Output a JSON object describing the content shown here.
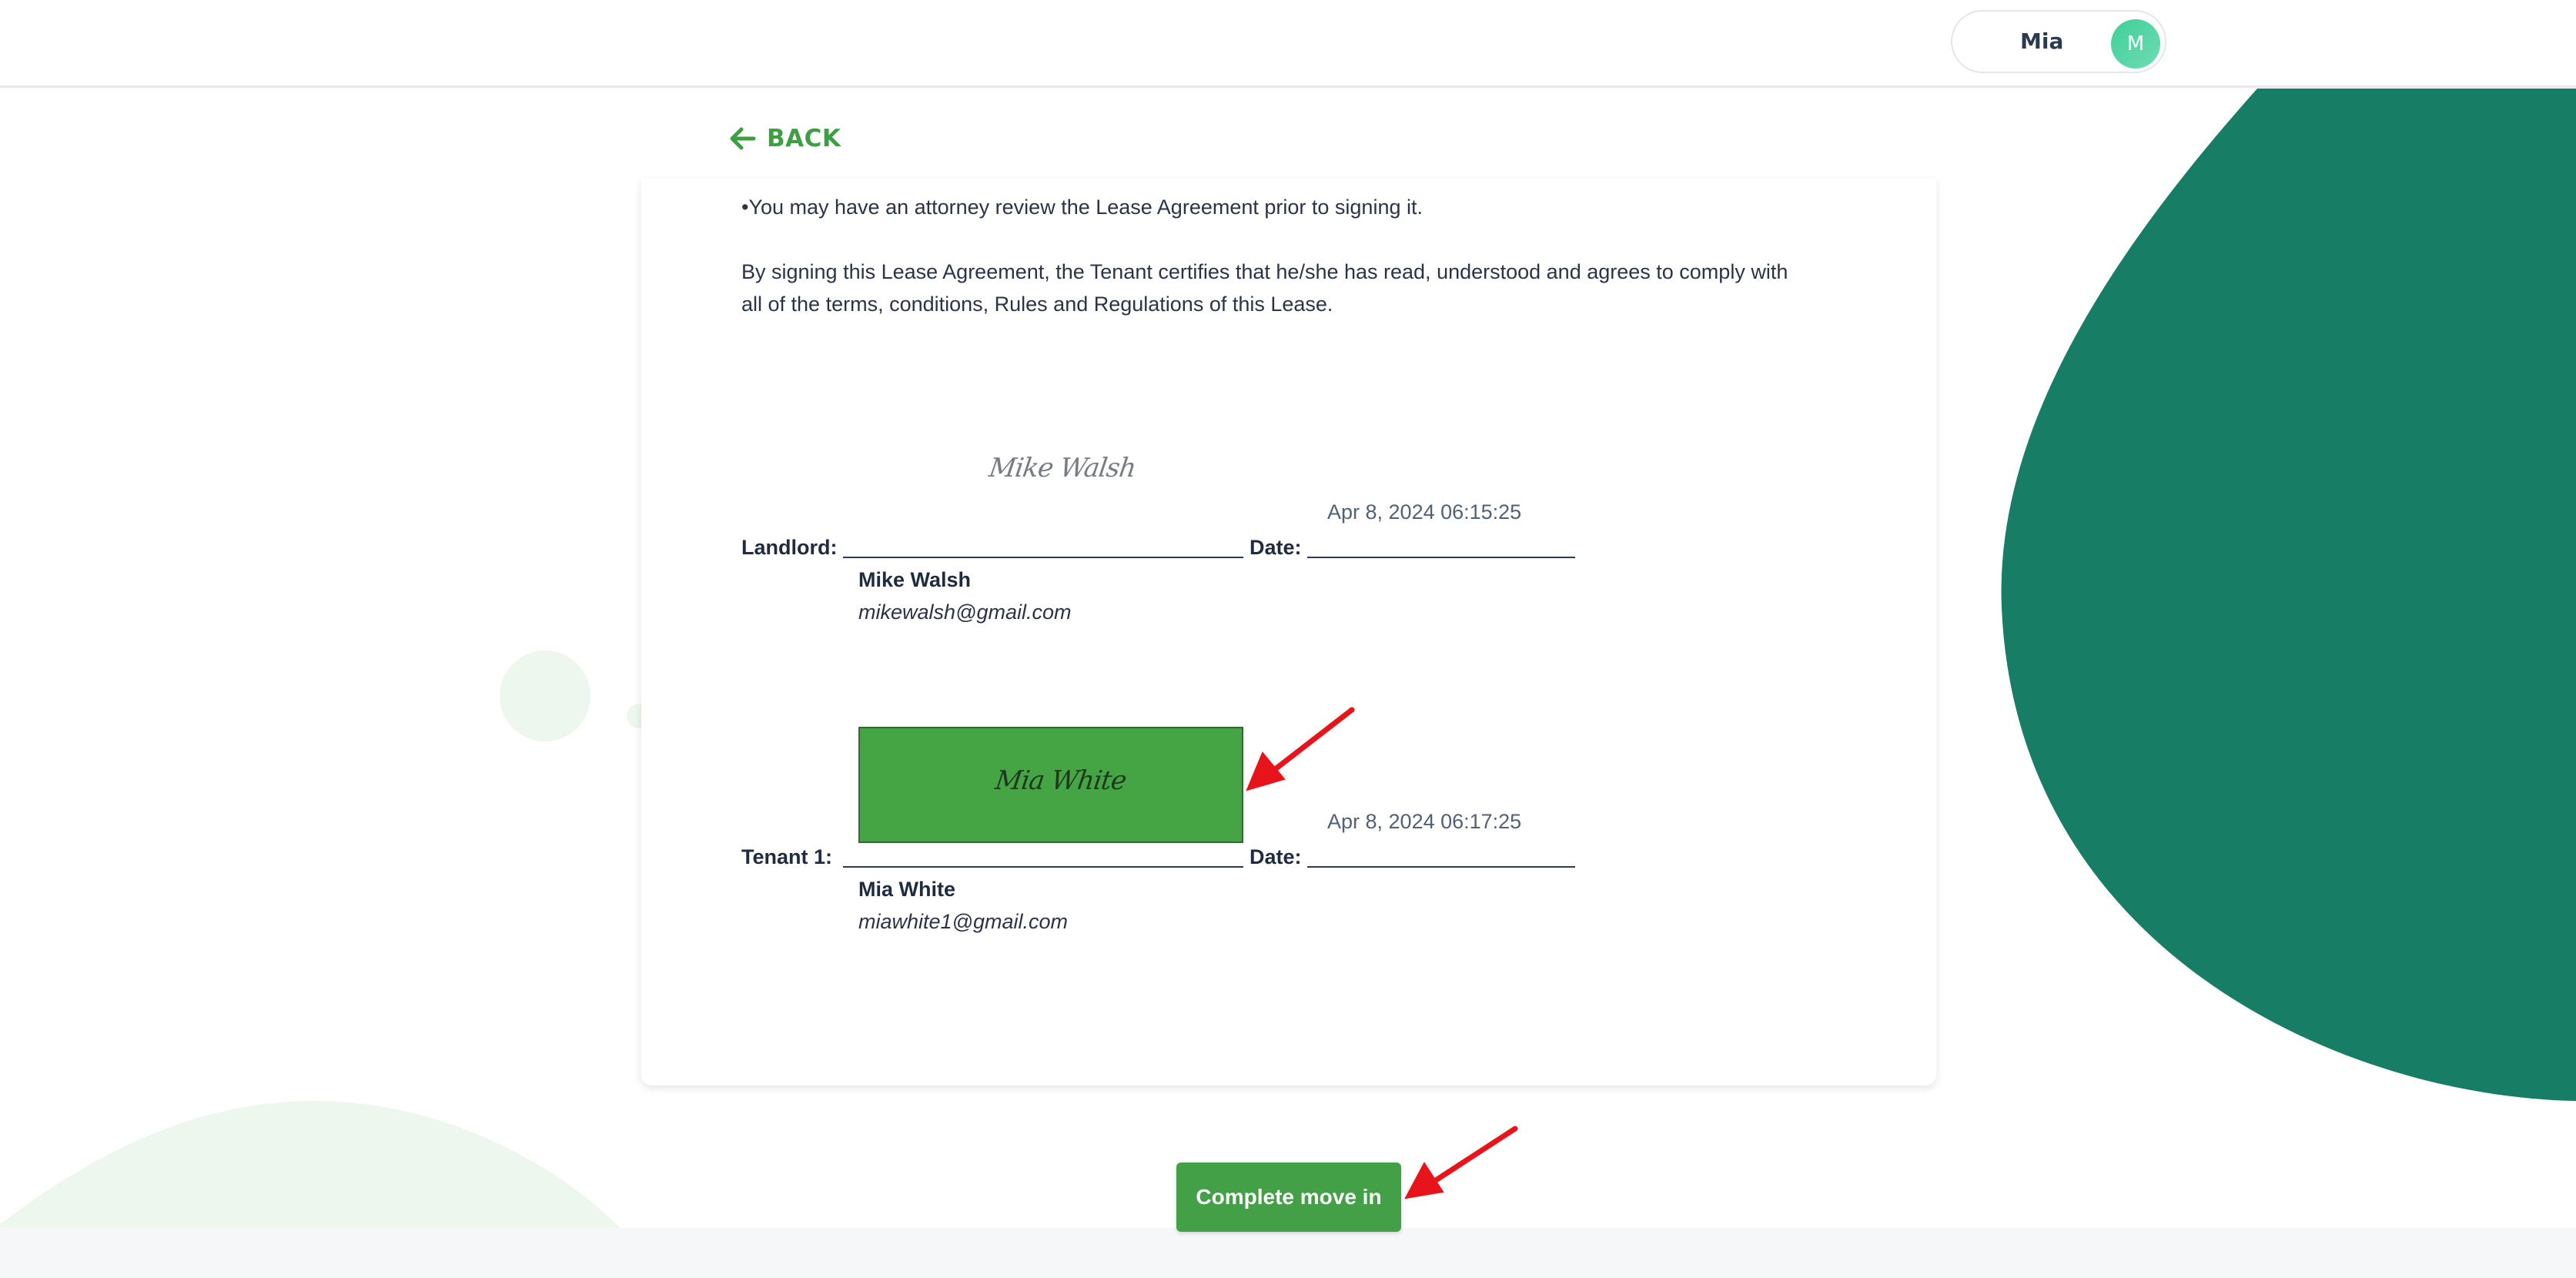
{
  "colors": {
    "brand_green": "#43a047",
    "teal_blob": "#177d64",
    "light_green_blob": "#eef7ee",
    "annotation_red": "#e8141b"
  },
  "header": {
    "user_name": "Mia",
    "avatar_initial": "M"
  },
  "nav": {
    "back_label": "BACK",
    "back_icon": "arrow-left-icon"
  },
  "document": {
    "line_attorney": "•You may have an attorney review the Lease Agreement prior to signing it.",
    "line_certify_1": "By signing this Lease Agreement, the Tenant certifies that he/she has read, understood and agrees to comply with",
    "line_certify_2": "all of the terms, conditions, Rules and Regulations of this Lease."
  },
  "signatures": {
    "date_label": "Date:",
    "landlord": {
      "label": "Landlord:",
      "signature_text": "Mike Walsh",
      "date": "Apr 8, 2024 06:15:25",
      "name": "Mike Walsh",
      "email": "mikewalsh@gmail.com"
    },
    "tenant": {
      "label": "Tenant 1:",
      "signature_text": "Mia White",
      "date": "Apr 8, 2024 06:17:25",
      "name": "Mia White",
      "email": "miawhite1@gmail.com"
    }
  },
  "actions": {
    "complete_label": "Complete move in"
  }
}
